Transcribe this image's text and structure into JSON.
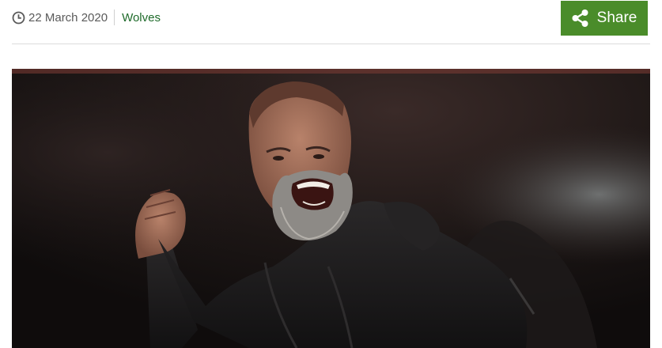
{
  "meta": {
    "date": "22 March 2020",
    "topic": "Wolves"
  },
  "share": {
    "label": "Share"
  },
  "colors": {
    "share_bg": "#4a8c2a",
    "topic_link": "#1f6b2b",
    "date_text": "#5a5a5a"
  },
  "icons": {
    "date": "clock-icon",
    "share": "share-icon"
  },
  "hero_image": {
    "subject": "bald bearded man in black padded jacket shouting and clenching fist in a stadium at night"
  }
}
